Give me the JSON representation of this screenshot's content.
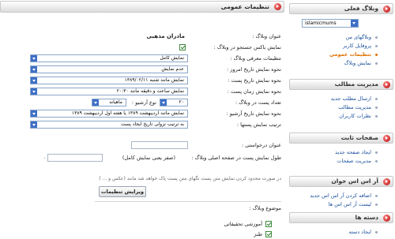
{
  "main": {
    "header_title": "تنظیمات عمومی",
    "fields": {
      "blog_title_label": "عنوان وبلاگ :",
      "blog_title_value": "مادران مذهبی",
      "show_search_label": "نمایش باکس جستجو در وبلاگ :",
      "intro_settings_label": "تنظیمات معرفی وبلاگ :",
      "intro_settings_value": "نمایش کامل",
      "today_date_label": "نحوه نمایش تاریخ امروز :",
      "today_date_value": "عدم نمایش",
      "post_date_label": "نحوه نمایش تاریخ پست :",
      "post_date_value": "نمایش مانند شنبه ۱۳۸۹/۰۲/۱۱",
      "post_time_label": "نحوه نمایش زمان پست :",
      "post_time_value": "نمایش ساعت و دقیقه مانند ۲۰:۳۰",
      "post_count_label": "تعداد پست در وبلاگ :",
      "post_count_value": "۲۰",
      "archive_type_label": "نوع آرشیو :",
      "archive_type_value": "ماهیانه",
      "archive_date_label": "نحوه نمایش تاریخ آرشیو :",
      "archive_date_value": "نمایش مانند اردیبهشت ۱۳۸۹ یا هفته اول اردیبهشت ۱۳۸۹",
      "post_order_label": "ترتیب نمایش پستها :",
      "post_order_value": "به ترتیب نزولی تاریخ ایجاد پست",
      "requested_title_label": "عنوان درخواستی :",
      "post_length_label": "طول نمایش پست در صفحه اصلی وبلاگ :",
      "post_length_hint": "(صفر یعنی نمایش کامل)",
      "note": "در صورت محدود کردن نمایش متن پست نگهای متن پست پاک خواهد شد مانند (عکس و ... )",
      "save_button": "ویرایش تنظیمات",
      "topic_label": "موضوع وبلاگ :",
      "topics": [
        "آموزشی تحقیقاتی",
        "طنز"
      ]
    }
  },
  "sidebar": {
    "sections": [
      {
        "title": "وبلاگ فعلی",
        "select_value": "islamicmums",
        "items": [
          {
            "label": "وبلاگهای من",
            "active": false
          },
          {
            "label": "پروفایل کاربر",
            "active": false
          },
          {
            "label": "تنظیمات عمومی",
            "active": true
          },
          {
            "label": "نمایش وبلاگ",
            "active": false
          }
        ]
      },
      {
        "title": "مدیریت مطالب",
        "items": [
          {
            "label": "ارسال مطلب جدید",
            "active": false
          },
          {
            "label": "مدیریت مطالب",
            "active": false
          },
          {
            "label": "نظرات کاربران",
            "active": false
          }
        ]
      },
      {
        "title": "صفحات ثابت",
        "items": [
          {
            "label": "ایجاد صفحه جدید",
            "active": false
          },
          {
            "label": "مدیریت صفحات",
            "active": false
          }
        ]
      },
      {
        "title": "آر اس اس خوان",
        "items": [
          {
            "label": "اضافه کردن آر اس اس جدید",
            "active": false
          },
          {
            "label": "لیست آر اس اس ها",
            "active": false
          }
        ]
      },
      {
        "title": "دسته ها",
        "items": [
          {
            "label": "ایجاد دسته",
            "active": false
          }
        ]
      }
    ]
  }
}
